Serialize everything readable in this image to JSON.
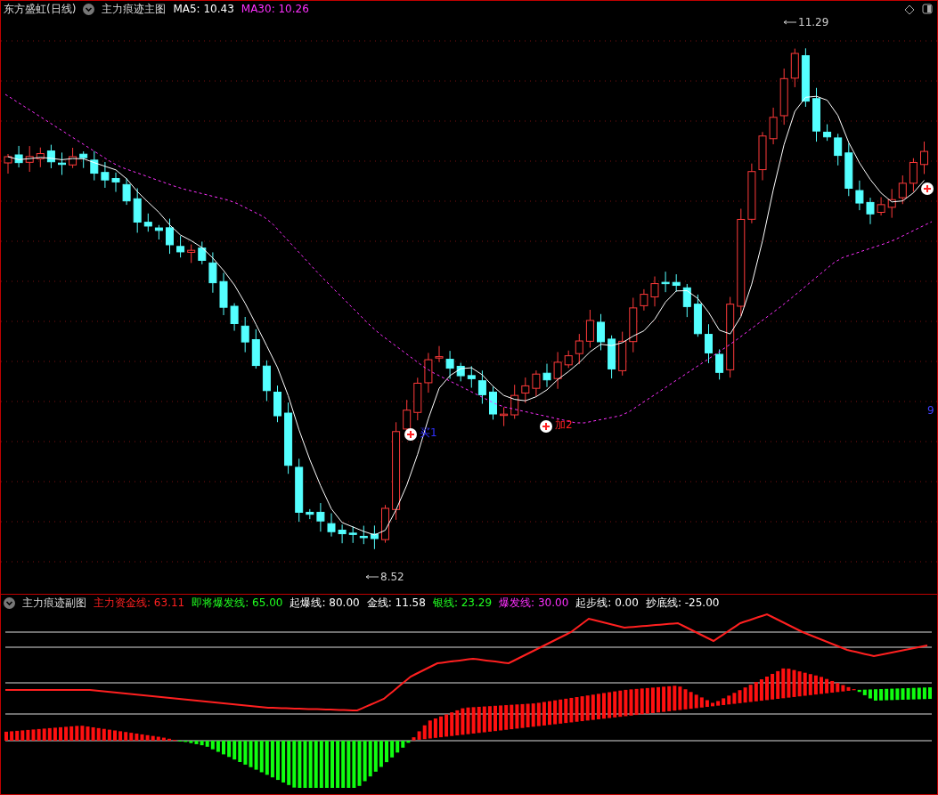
{
  "main_chart": {
    "title": "东方盛虹(日线)",
    "indicator": "主力痕迹主图",
    "readings": [
      {
        "text": "MA5: 10.43",
        "color": "#ffffff"
      },
      {
        "text": "MA30: 10.26",
        "color": "#ff30ff"
      }
    ],
    "high_label": "11.29",
    "low_label": "8.52",
    "edge_label": "9",
    "signals": [
      {
        "kind": "buy",
        "text": "买1"
      },
      {
        "kind": "add",
        "text": "加2"
      },
      {
        "kind": "add"
      }
    ]
  },
  "sub_chart": {
    "title": "主力痕迹副图",
    "readings": [
      {
        "text": "主力资金线: 63.11",
        "color": "#ff2020"
      },
      {
        "text": "即将爆发线: 65.00",
        "color": "#20ff20"
      },
      {
        "text": "起爆线: 80.00",
        "color": "#ffffff"
      },
      {
        "text": "金线: 11.58",
        "color": "#ffffff"
      },
      {
        "text": "银线: 23.29",
        "color": "#20ff20"
      },
      {
        "text": "爆发线: 30.00",
        "color": "#ff30ff"
      },
      {
        "text": "起步线: 0.00",
        "color": "#ffffff"
      },
      {
        "text": "抄底线: -25.00",
        "color": "#ffffff"
      }
    ]
  }
}
